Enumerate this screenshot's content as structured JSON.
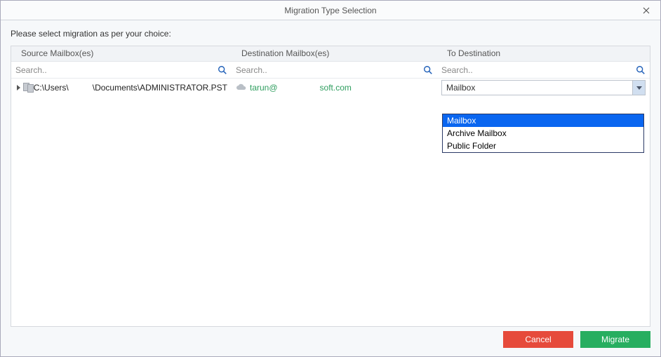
{
  "window": {
    "title": "Migration Type Selection",
    "close_label": "Close"
  },
  "instruction": "Please select migration as per your choice:",
  "columns": {
    "source": "Source Mailbox(es)",
    "destination": "Destination Mailbox(es)",
    "to_destination": "To Destination"
  },
  "search": {
    "placeholder": "Search.."
  },
  "row": {
    "source_prefix": "C:\\Users\\",
    "source_suffix": "\\Documents\\ADMINISTRATOR.PST",
    "dest_prefix": "tarun@",
    "dest_suffix": "soft.com",
    "combo_selected": "Mailbox"
  },
  "dropdown": {
    "options": [
      "Mailbox",
      "Archive Mailbox",
      "Public Folder"
    ],
    "selected_index": 0
  },
  "buttons": {
    "cancel": "Cancel",
    "migrate": "Migrate"
  },
  "colors": {
    "highlight": "#0a66f0",
    "cancel": "#e64a3b",
    "migrate": "#27ae60",
    "link_green": "#2f9e5f"
  }
}
